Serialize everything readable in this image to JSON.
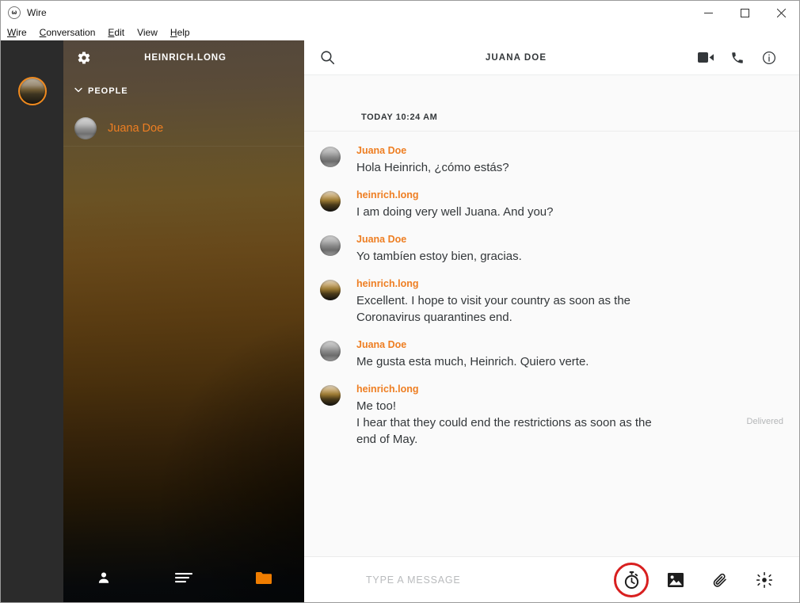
{
  "window": {
    "app_title": "Wire",
    "logo_glyph": "ω",
    "controls": {
      "minimize": "minimize-icon",
      "maximize": "maximize-icon",
      "close": "close-icon"
    }
  },
  "menubar": {
    "items": [
      {
        "label": "Wire",
        "accel": "W",
        "rest": "ire"
      },
      {
        "label": "Conversation",
        "accel": "C",
        "rest": "onversation"
      },
      {
        "label": "Edit",
        "accel": "E",
        "rest": "dit"
      },
      {
        "label": "View",
        "accel": "V",
        "rest": "iew"
      },
      {
        "label": "Help",
        "accel": "H",
        "rest": "elp"
      }
    ]
  },
  "rail": {
    "self_avatar": "self-avatar",
    "accent": "#f08a1e"
  },
  "sidebar": {
    "settings_icon": "gear-icon",
    "account_name": "HEINRICH.LONG",
    "section": {
      "chevron": "chevron-down-icon",
      "label": "PEOPLE"
    },
    "conversations": [
      {
        "name": "Juana Doe",
        "avatar": "juana-avatar",
        "selected": true
      }
    ],
    "footer": [
      {
        "icon": "person-icon",
        "name": "contacts-button"
      },
      {
        "icon": "list-icon",
        "name": "conversations-button"
      },
      {
        "icon": "folder-icon",
        "name": "archive-button"
      }
    ],
    "name_color": "#ee7e22"
  },
  "conversation": {
    "header": {
      "search_icon": "search-icon",
      "title": "JUANA DOE",
      "actions": [
        {
          "icon": "video-call-icon",
          "name": "video-call-button"
        },
        {
          "icon": "phone-call-icon",
          "name": "audio-call-button"
        },
        {
          "icon": "info-icon",
          "name": "conversation-info-button"
        }
      ]
    },
    "day_divider": "TODAY 10:24 AM",
    "messages": [
      {
        "sender": "Juana Doe",
        "avatar": "juana",
        "lines": [
          "Hola Heinrich, ¿cómo estás?"
        ],
        "status": ""
      },
      {
        "sender": "heinrich.long",
        "avatar": "heinrich",
        "lines": [
          "I am doing very well Juana. And you?"
        ],
        "status": ""
      },
      {
        "sender": "Juana Doe",
        "avatar": "juana",
        "lines": [
          "Yo tambíen estoy bien, gracias."
        ],
        "status": ""
      },
      {
        "sender": "heinrich.long",
        "avatar": "heinrich",
        "lines": [
          "Excellent. I hope to visit your country as soon as the Coronavirus quarantines end."
        ],
        "status": ""
      },
      {
        "sender": "Juana Doe",
        "avatar": "juana",
        "lines": [
          "Me gusta esta much, Heinrich. Quiero verte."
        ],
        "status": ""
      },
      {
        "sender": "heinrich.long",
        "avatar": "heinrich",
        "lines": [
          "Me too!",
          "I hear that they could end the restrictions as soon as the end of May."
        ],
        "status": "Delivered"
      }
    ],
    "composer": {
      "placeholder": "TYPE A MESSAGE",
      "value": "",
      "buttons": [
        {
          "icon": "timer-icon",
          "name": "ephemeral-timer-button",
          "highlighted": true
        },
        {
          "icon": "image-icon",
          "name": "add-image-button",
          "highlighted": false
        },
        {
          "icon": "paperclip-icon",
          "name": "add-file-button",
          "highlighted": false
        },
        {
          "icon": "ping-icon",
          "name": "ping-button",
          "highlighted": false
        }
      ],
      "highlight_color": "#d81f1f"
    }
  }
}
